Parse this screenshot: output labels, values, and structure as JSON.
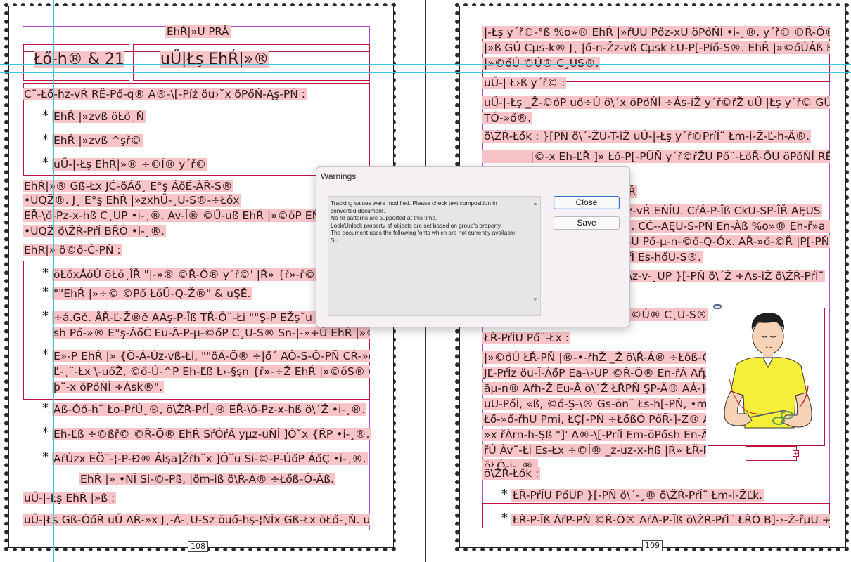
{
  "dialog": {
    "title": "Warnings",
    "messages": [
      "Tracking values were modified. Please check text composition in converted document.",
      "No fill patterns are supported at this time.",
      "Lock/Unlock property of objects are set based on group's property.",
      "The document uses the following fonts which are not currently available.",
      "SH"
    ],
    "close_label": "Close",
    "save_label": "Save"
  },
  "left_page": {
    "page_number": "108",
    "header": "EhŔ|»U PRÂ",
    "title_left": "Łő-h® & 21",
    "title_right": "uŰ|Łş EhŔ|»®",
    "intro": "C¨-Łő-hz-vŔ RĚ-Pő-q® A®-\\[-Píź öu›˘x öPőŃ-Ąş-PŇ :",
    "bullets1": [
      "EhŔ |»zvß öŁő¸Ň",
      "EhŔ |»zvß ^şř©",
      "uŰ-|-Łş EhŔ|»® ÷©Í® y´ř©"
    ],
    "para1": [
      "EhŔ|»®    Gß-Łx    JĆ-öÁő¸    E°ş    ÁőĚ-ÂŘ-S®",
      "•UQŽ®.    J¸    E°ş    EhŔ    |»zxhŰ-¸U-S®-÷Łőx",
      "EŘ-\\ő-Pz-x-hß C¸UP •i-¸®. Av-Í® ©Ű-uß EhŔ |»©őP EŃÍ-÷Łőx",
      "•UQŽ ö\\ŽŔ-PŕÍ BŘÓ •i-¸®."
    ],
    "section2": "EhŔ|» ö©ő-Č-PŇ :",
    "bullets2": [
      [
        "öŁőxÁőÚ öŁő¸ÎŘ \"|-»® ©Ř-Ö® y´ř©' |Ŕ» {ř»-ř©-°-Ľ-¸¨-Ł÷"
      ],
      [
        "\"\"EhŔ |»÷© ©Pő ŁőŰ-Q-Ž®\" & uŞĚ."
      ],
      [
        "÷á.Gě. ÂŘ-Ľ-Ž®ě AAş-P-Îß TŘ-Ö¨-Łi \"\"Ş-P EŽş˘u ÷\\ŕÁ",
        "sh Pő-»® E°ş-ÁőĆ Eu-Â-P-µ-©őP C¸U-S® Sn-|-»÷Ú EhŔ |»®\"."
      ],
      [
        "E»-P EhŔ |» {Ö-Á-Úz-vß-Łi, \"\"öÁ-Ö® ÷|ő´ AÔ-S-Ô-PŇ CŔ-»ő-©-",
        "Ľ-¸¨-Łx \\-uőŽ, ©ő-Ú-^P Eh-Ľß Ł›-§şn {ř»-÷Ž EhŔ |»©őS® GßÖ",
        "þ¨-x öPőŃÍ ÷Ásk®\"."
      ],
      [
        "Aß-Óő-h¨ Ło-PŕÚ¸®, ö\\ŽŔ-PŕÍ¸® EŘ-\\ő-Pz-x-hß ö\\´Ž •i-¸®."
      ],
      [
        "Eh-Ľß ÷©ßř© ©Ř-Ö® EhŔ SŕÓŕÁ yµz-uŇÎ ]Ó˘x {ŘP •i-¸®."
      ],
      [
        "AŕÚzx EÖ¨-¦-P-Đ® Álşa]Žřh˘x ]Ó˘u Si-©-P-ÚőP ÁőÇ •i-¸®."
      ]
    ],
    "indented": "EhŔ |» •ŃÍ Si-©-Pß, |öm-iß ö\\Ř-Á® ÷Łőß-Ó-Áß.",
    "section3": "uŰ-|-Łş EhŔ |»ß :",
    "last_line": "uŰ-|Łş  Gß-ÓőŘ uŰ AŔ-»x J¸-Á-¸U-Sz öuő-hş-¦ŃÍx Gß-Łx öŁő-¸Ň. uŰ-"
  },
  "right_page": {
    "page_number": "109",
    "top_lines": [
      "|-Łş y´ř©-°ß %o»® EhŔ |»řUU Pőz-xU öPőŃÍ •i-¸®.   y´ř© ©Ř-Ö® EhŔ",
      "|»ß GÚ Cµs-k® J¸ |ő-n-Žz-vß Cµsk ŁU-P[-Píő-S®. EhŔ |»©őÚÁß EhĽŘ",
      "|»©őÚ ©Ú® C¸US®."
    ],
    "heading1": "uŰ-| Ł›ß y´ř© :",
    "para1": [
      "uŰ-|-Łş _Ž-©őP uő÷Ú ö\\´x öPőŃÍ ÷Ás-iŽ y´ř©řŽ uŰ |Łş y´ř© GÚU",
      "TÓ-»ő®."
    ],
    "para2": "ö\\ŽŔ-Łők : }[PŇ ö\\´-ŽU-T-iŽ uŰ-|-Łş y´ř©PríÍ¨ Łm-i-Ž-Ľ-h-Ä®.",
    "para3": "|©-x Eh-ĽŘ ]» Łő-P[-PŰŇ y´ř©řŽU Pő¨-ŁőŘ-ÔU öPőŃÍ RĚU-Ps-",
    "frag_a": "ÚŘ",
    "frag_b": "Pz-vŔ EŃÍU.  CŕÁ-P-Îß CkU-SP-ÎŘ AĘUS",
    "frag_c": "®.  CĆ--AĘU-S-PŇ En-Âß %o»® Eh-ř»a ÷\\",
    "frag_d": "-SU Pő-µ-n-©ő-Q-Óx. AŘ-»ő-©Ř |P[-PŇ",
    "frag_e": "PŕÍ Es-hőU-S®.",
    "frag_f": "řÁz-v-¸UP }[-PŇ ö\\´Ž ÷Ás-iŽ ö\\ŽŔ-PŕÍ¨",
    "frag_g": "©Ú® C¸U-S®.",
    "heading2": "ŁŘ-PŕÍU Pő¨-Łx :",
    "para4": [
      "|»©őÚ ŁŘ-PŇ |®-•-řhŽ _Ž ö\\Ř-Á® ÷Łőß-Óx.",
      "JĽ-PŕÍz öu-Î-ÁőP Ea-\\›UP ©Ř-Ö® En-řÁ Aŕµzx",
      "ăµ-n® Ařh-Ž Eu-Â ö\\´Ž ŁŘPŇ ŞP-Ä® AÁ-]-Ž®.",
      "uU-PőÍ, «ß, ©ő-Ş-\\® Gs-ön¨ Łs-h[-PŇ, •mřh,",
      "Łő-»ő-řhU Pmi, ŁÇ[-PŇ ÷ŁőßÓ PőŘ-]-Ž® AŘ-",
      "»x řÁrn-h-Şß \"]' A®-\\[-PríÍ Em-öPősh En-Â-P-",
      "řÚ Âv¨-Łi Es-Łx ÷©Í® _z-uz-x-hß |Ŕ» ŁŘ-PŕÍ¨",
      "öŁÓ-i-¸®."
    ],
    "heading3": "ö\\ŽŔ-Łők :",
    "bullets": [
      "ŁŘ-PŕÍU PőUP }[-PŇ ö\\´-¸® ö\\ŽŔ-PŕÍ¨ Łm-i-ŽĽk.",
      "ŁŘ-P-Îß ÁŕP-PŇ ©Ř-Ö® AŕÁ-P-Îß ö\\ŽŔ-PŕÍ¨ ŁŘÔ B]-›-Ž-řµU ÷Pmkz"
    ]
  }
}
